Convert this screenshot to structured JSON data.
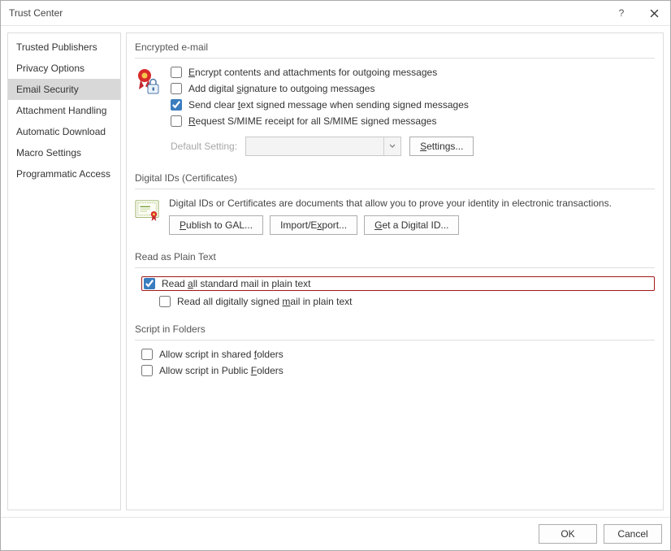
{
  "window": {
    "title": "Trust Center"
  },
  "sidebar": {
    "items": [
      {
        "label": "Trusted Publishers"
      },
      {
        "label": "Privacy Options"
      },
      {
        "label": "Email Security"
      },
      {
        "label": "Attachment Handling"
      },
      {
        "label": "Automatic Download"
      },
      {
        "label": "Macro Settings"
      },
      {
        "label": "Programmatic Access"
      }
    ]
  },
  "sections": {
    "encrypted": {
      "title": "Encrypted e-mail",
      "checks": [
        {
          "pre": "",
          "u": "E",
          "post": "ncrypt contents and attachments for outgoing messages",
          "checked": false
        },
        {
          "pre": "Add digital ",
          "u": "s",
          "post": "ignature to outgoing messages",
          "checked": false
        },
        {
          "pre": "Send clear ",
          "u": "t",
          "post": "ext signed message when sending signed messages",
          "checked": true
        },
        {
          "pre": "",
          "u": "R",
          "post": "equest S/MIME receipt for all S/MIME signed messages",
          "checked": false
        }
      ],
      "default_label": "Default Setting:",
      "settings_btn_u": "S",
      "settings_btn_post": "ettings..."
    },
    "digital": {
      "title": "Digital IDs (Certificates)",
      "desc": "Digital IDs or Certificates are documents that allow you to prove your identity in electronic transactions.",
      "btns": [
        {
          "u": "P",
          "post": "ublish to GAL..."
        },
        {
          "pre": "Import/E",
          "u": "x",
          "post": "port..."
        },
        {
          "u": "G",
          "post": "et a Digital ID..."
        }
      ]
    },
    "plain": {
      "title": "Read as Plain Text",
      "checks": [
        {
          "pre": "Read ",
          "u": "a",
          "post": "ll standard mail in plain text",
          "checked": true,
          "highlight": true
        },
        {
          "pre": "Read all digitally signed ",
          "u": "m",
          "post": "ail in plain text",
          "checked": false
        }
      ]
    },
    "script": {
      "title": "Script in Folders",
      "checks": [
        {
          "pre": "Allow script in shared ",
          "u": "f",
          "post": "olders",
          "checked": false
        },
        {
          "pre": "Allow script in Public ",
          "u": "F",
          "post": "olders",
          "checked": false
        }
      ]
    }
  },
  "footer": {
    "ok": "OK",
    "cancel": "Cancel"
  }
}
